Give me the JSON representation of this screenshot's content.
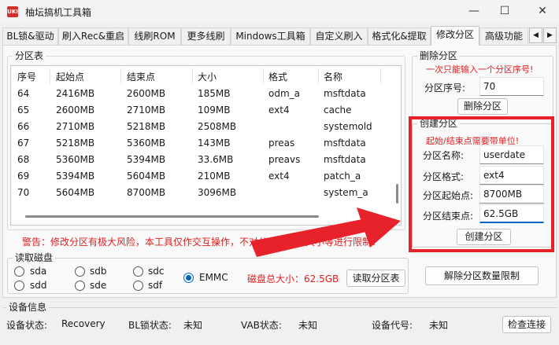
{
  "window": {
    "title": "柚坛搞机工具箱",
    "icon_text": "UKI",
    "minimize": "—",
    "maximize": "☐",
    "close": "✕"
  },
  "tabs": [
    {
      "label": "BL锁&驱动"
    },
    {
      "label": "刷入Rec&重启"
    },
    {
      "label": "线刷ROM"
    },
    {
      "label": "更多线刷"
    },
    {
      "label": "Mindows工具箱"
    },
    {
      "label": "自定义刷入"
    },
    {
      "label": "格式化&提取"
    },
    {
      "label": "修改分区"
    },
    {
      "label": "高级功能"
    }
  ],
  "tab_scroll": {
    "left": "◀",
    "right": "▶"
  },
  "partition_table": {
    "title": "分区表",
    "columns": [
      "序号",
      "起始点",
      "结束点",
      "大小",
      "格式",
      "名称"
    ],
    "rows": [
      [
        "64",
        "2416MB",
        "2600MB",
        "185MB",
        "odm_a",
        "msftdata"
      ],
      [
        "65",
        "2600MB",
        "2710MB",
        "109MB",
        "ext4",
        "cache"
      ],
      [
        "66",
        "2710MB",
        "5218MB",
        "2508MB",
        "",
        "systemold"
      ],
      [
        "67",
        "5218MB",
        "5360MB",
        "143MB",
        "preas",
        "msftdata"
      ],
      [
        "68",
        "5360MB",
        "5394MB",
        "33.6MB",
        "preavs",
        "msftdata"
      ],
      [
        "69",
        "5394MB",
        "5604MB",
        "210MB",
        "ext4",
        "patch_a"
      ],
      [
        "70",
        "5604MB",
        "8700MB",
        "3096MB",
        "",
        "system_a"
      ]
    ]
  },
  "warning": "警告：修改分区有极大风险，本工具仅作交互操作，不对分区数量、大小等进行限制！",
  "delete_partition": {
    "title": "删除分区",
    "note": "一次只能输入一个分区序号!",
    "index_label": "分区序号:",
    "index_value": "70",
    "button": "删除分区"
  },
  "create_partition": {
    "title": "创建分区",
    "note": "起始/结束点需要带单位!",
    "name_label": "分区名称:",
    "name_value": "userdate",
    "format_label": "分区格式:",
    "format_value": "ext4",
    "start_label": "分区起始点:",
    "start_value": "8700MB",
    "end_label": "分区结束点:",
    "end_value": "62.5GB",
    "button": "创建分区"
  },
  "disk": {
    "title": "读取磁盘",
    "options": [
      "sda",
      "sdb",
      "sdc",
      "sdd",
      "sde",
      "sdf",
      "EMMC"
    ],
    "selected": "EMMC",
    "total_size": "磁盘总大小：62.5GB",
    "read_button": "读取分区表"
  },
  "unlock_limit_button": "解除分区数量限制",
  "device_info": {
    "title": "设备信息",
    "status_label": "设备状态:",
    "status_value": "Recovery",
    "bl_label": "BL锁状态:",
    "bl_value": "未知",
    "vab_label": "VAB状态:",
    "vab_value": "未知",
    "code_label": "设备代号:",
    "code_value": "未知",
    "check_button": "检查连接"
  },
  "colors": {
    "highlight": "#e8222a",
    "warning_text": "#e02020",
    "accent": "#0067c0"
  }
}
